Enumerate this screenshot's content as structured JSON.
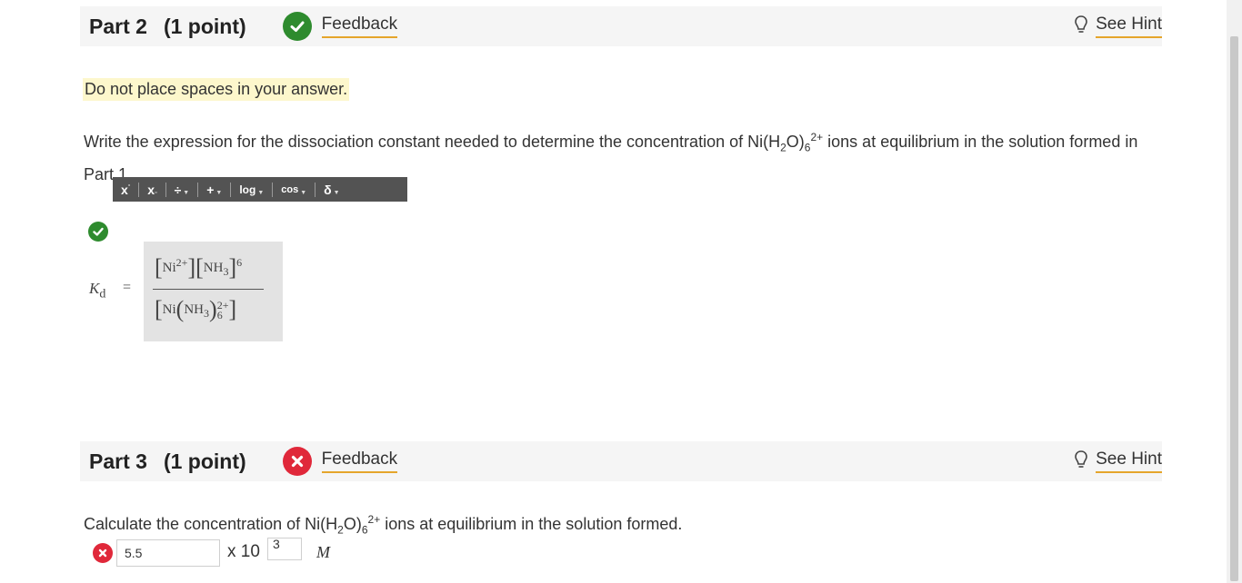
{
  "part2": {
    "title": "Part 2",
    "points": "(1 point)",
    "feedback_label": "Feedback",
    "hint_label": "See Hint",
    "status": "correct",
    "note": "Do not place spaces in your answer.",
    "question_pre": "Write the expression for the dissociation constant needed to determine the concentration of Ni(H",
    "question_sub1": "2",
    "question_mid": "O)",
    "question_sub2": "6",
    "question_sup": "2+",
    "question_post": " ions at equilibrium in the solution formed in Part 1.",
    "toolbar": {
      "superscript": "x",
      "subscript": "x",
      "fraction": "÷",
      "plusminus": "+",
      "log": "log",
      "cos": "cos",
      "delta": "δ"
    },
    "answer": {
      "lhs": "K",
      "lhs_sub": "d",
      "eq": "=",
      "num_species1": "Ni",
      "num_species1_sup": "2+",
      "num_species2": "NH",
      "num_species2_sub": "3",
      "num_exp": "6",
      "den_species": "Ni",
      "den_ligand": "NH",
      "den_ligand_sub": "3",
      "den_sub": "6",
      "den_sup": "2+"
    }
  },
  "part3": {
    "title": "Part 3",
    "points": "(1 point)",
    "feedback_label": "Feedback",
    "hint_label": "See Hint",
    "status": "incorrect",
    "question_pre": "Calculate the concentration of Ni(H",
    "question_sub1": "2",
    "question_mid": "O)",
    "question_sub2": "6",
    "question_sup": "2+",
    "question_post": " ions at equilibrium in the solution formed.",
    "answer_value": "5.5",
    "times_label": "x 10",
    "exponent_value": "3",
    "unit": "M"
  },
  "colors": {
    "correct": "#2e8b2e",
    "incorrect": "#e0283a",
    "link_underline": "#e5a52b",
    "note_highlight": "#fdf7cc",
    "toolbar_bg": "#535353"
  }
}
